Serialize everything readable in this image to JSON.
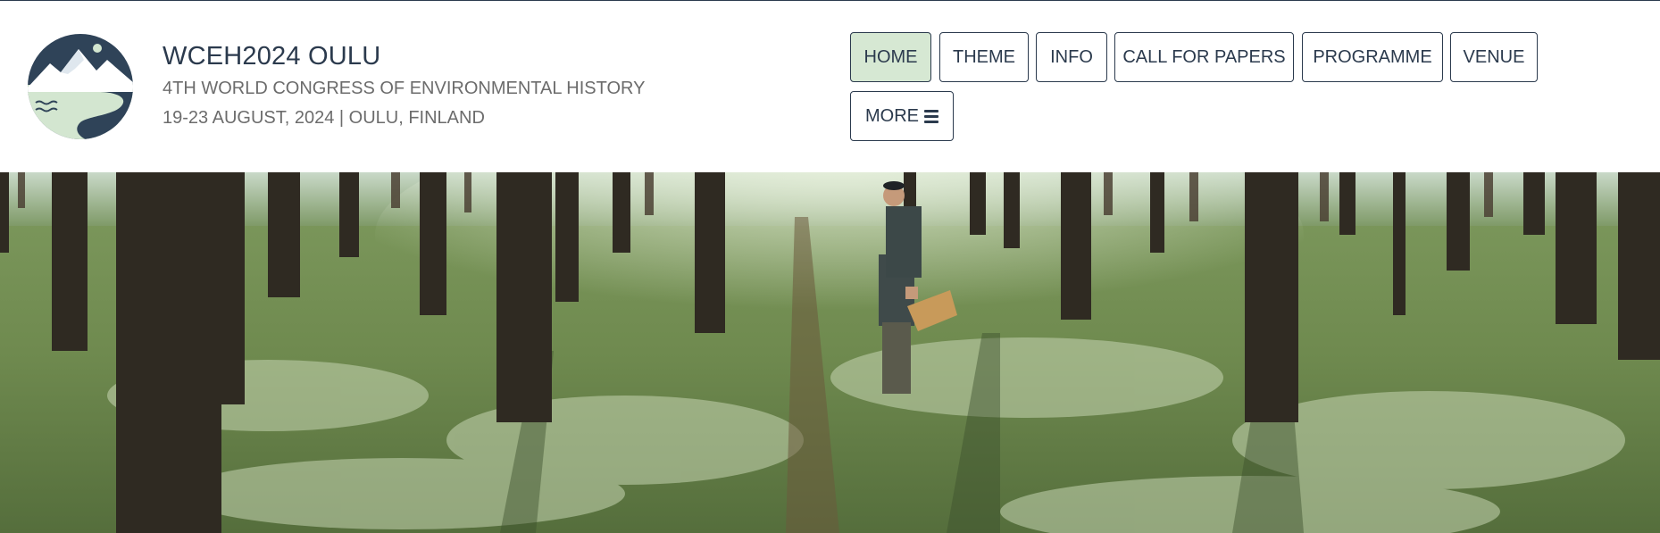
{
  "header": {
    "title": "WCEH2024 OULU",
    "subtitle": "4TH WORLD CONGRESS OF ENVIRONMENTAL HISTORY",
    "date_location": "19-23 AUGUST, 2024 | OULU, FINLAND",
    "logo_icon": "mountain-lake-logo-icon"
  },
  "nav": {
    "items": [
      {
        "label": "HOME",
        "active": true
      },
      {
        "label": "THEME",
        "active": false
      },
      {
        "label": "INFO",
        "active": false
      },
      {
        "label": "CALL FOR PAPERS",
        "active": false
      },
      {
        "label": "PROGRAMME",
        "active": false
      },
      {
        "label": "VENUE",
        "active": false
      }
    ],
    "more": {
      "label": "MORE",
      "icon": "hamburger-menu-icon"
    }
  },
  "colors": {
    "primary": "#2b3a4d",
    "active_bg": "#d6e8d3",
    "secondary_text": "#6c6c6c"
  },
  "hero": {
    "image_icon": "forest-with-man-holding-basket-photo"
  }
}
